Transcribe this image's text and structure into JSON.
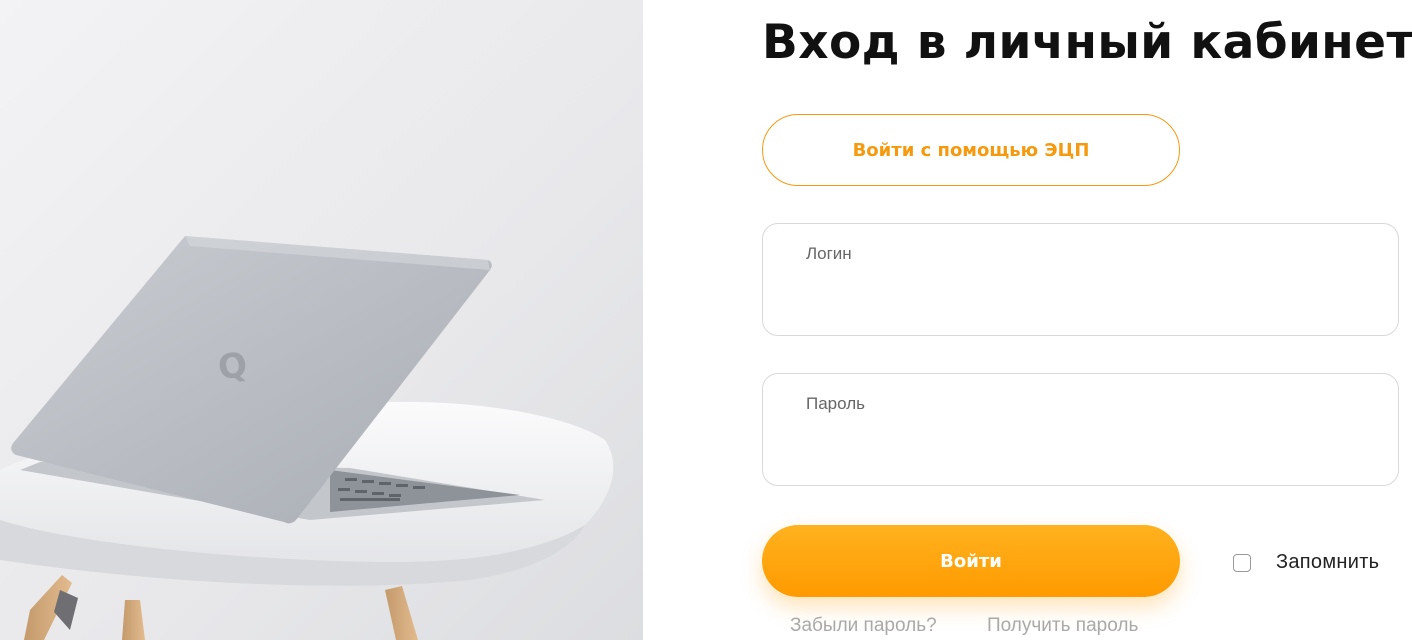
{
  "page": {
    "title": "Вход в личный кабинет"
  },
  "hero_image": {
    "description_icon": "laptop-on-chair-photo",
    "logo_letter": "Q"
  },
  "form": {
    "ecp_button_label": "Войти с помощью ЭЦП",
    "login": {
      "label": "Логин",
      "value": ""
    },
    "password": {
      "label": "Пароль",
      "value": ""
    },
    "submit_label": "Войти",
    "remember": {
      "label": "Запомнить",
      "checked": false
    },
    "links": {
      "forgot_password": "Забыли пароль?",
      "get_password": "Получить пароль"
    }
  },
  "colors": {
    "accent": "#ff9a00",
    "accent_outline": "#f59a0f",
    "title": "#111111",
    "muted_link": "#a9a9a9",
    "field_border": "#d9d9d9"
  }
}
